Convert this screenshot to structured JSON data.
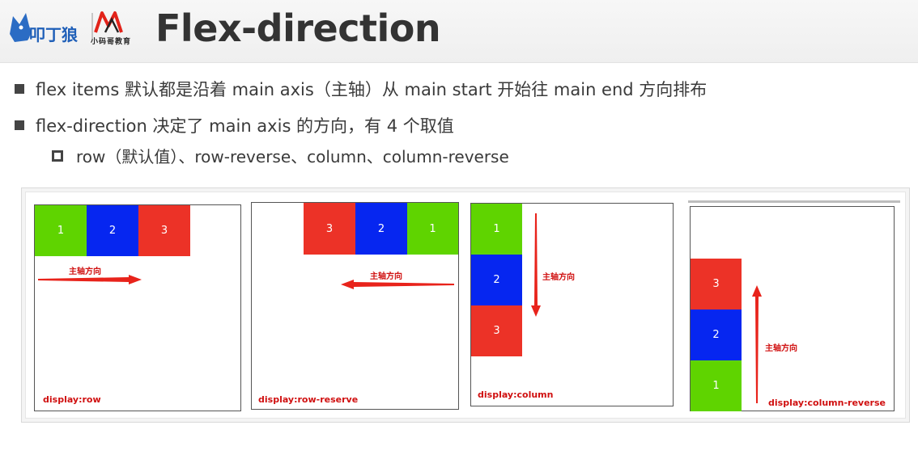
{
  "header": {
    "title": "Flex-direction",
    "logo_sub_text": "小码哥教育"
  },
  "bullets": [
    "flex items 默认都是沿着 main axis（主轴）从 main start 开始往 main end 方向排布",
    "flex-direction 决定了 main axis 的方向，有 4 个取值"
  ],
  "sub_bullet": "row（默认值）、row-reverse、column、column-reverse",
  "panels": [
    {
      "caption": "display:row",
      "axis_label": "主轴方向",
      "items": [
        "1",
        "2",
        "3"
      ]
    },
    {
      "caption": "display:row-reserve",
      "axis_label": "主轴方向",
      "items": [
        "3",
        "2",
        "1"
      ]
    },
    {
      "caption": "display:column",
      "axis_label": "主轴方向",
      "items": [
        "1",
        "2",
        "3"
      ]
    },
    {
      "caption": "display:column-reverse",
      "axis_label": "主轴方向",
      "items": [
        "3",
        "2",
        "1"
      ]
    }
  ],
  "colors": {
    "green": "#5fd400",
    "blue": "#0626f0",
    "red": "#ec3227",
    "arrow": "#e8231b"
  }
}
